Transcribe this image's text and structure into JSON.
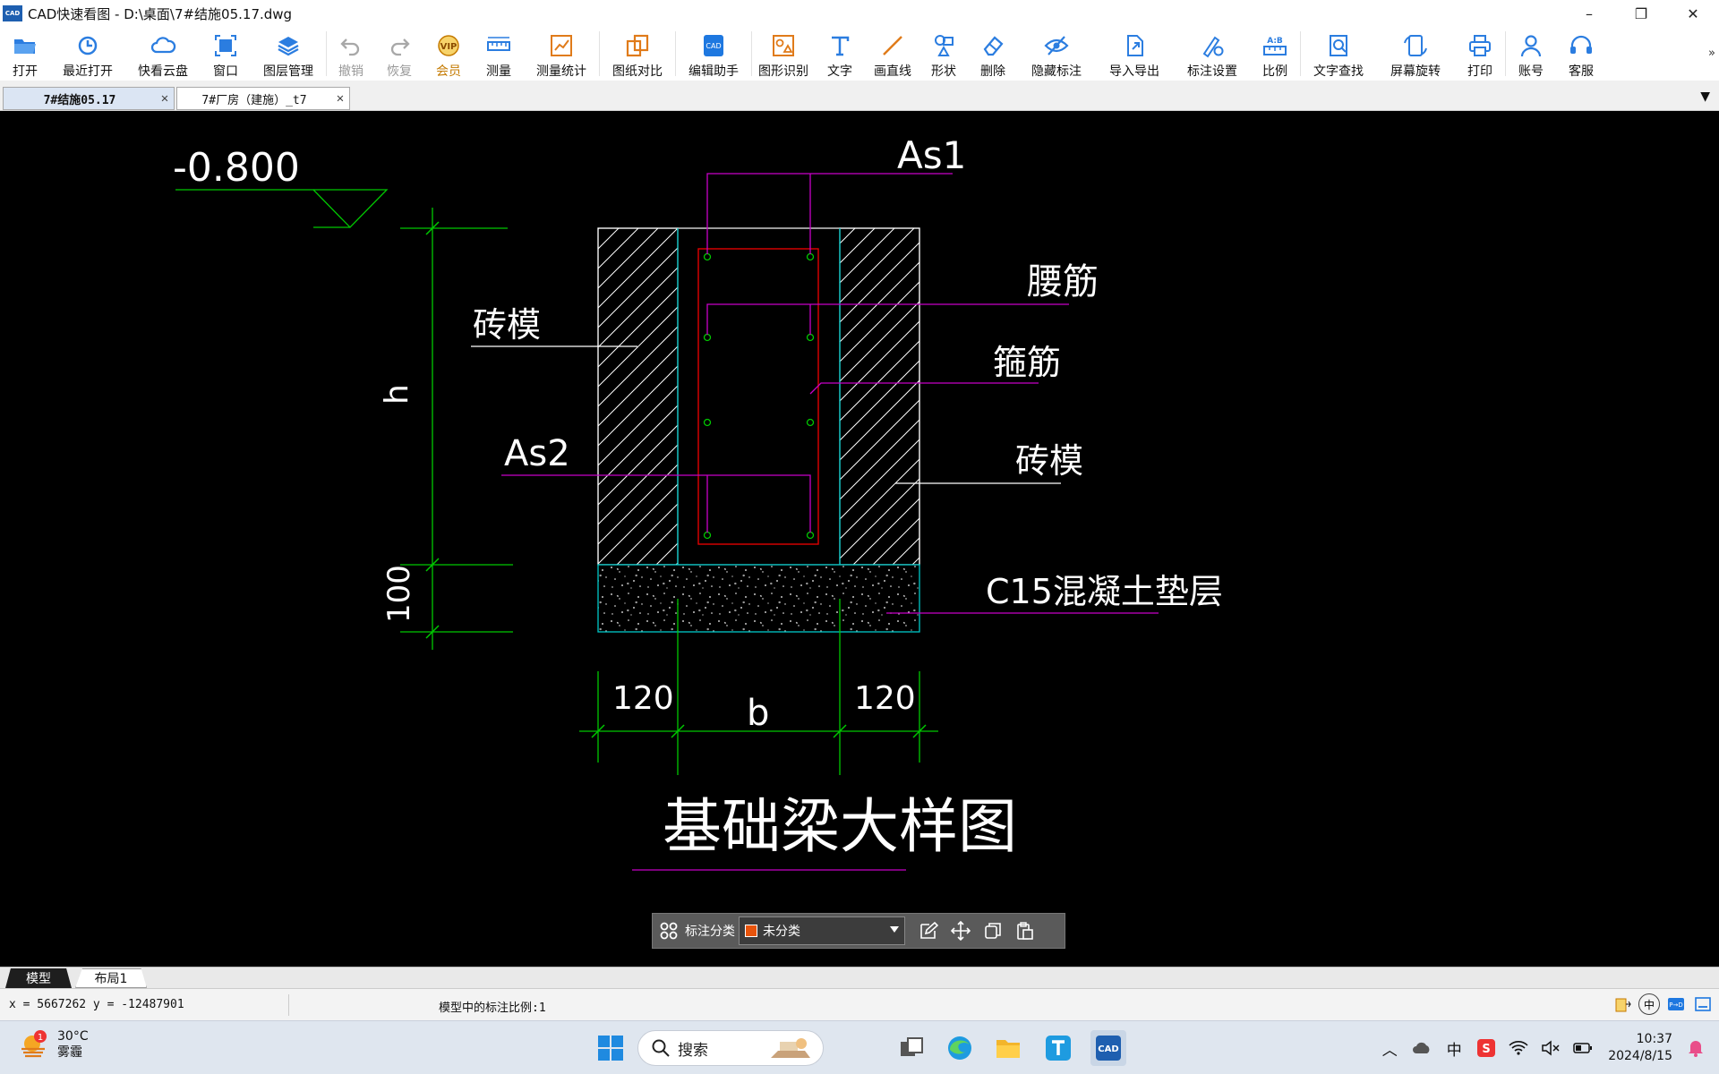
{
  "window": {
    "app_icon_text": "CAD",
    "title": "CAD快速看图 - D:\\桌面\\7#结施05.17.dwg",
    "minimize": "–",
    "restore": "❐",
    "close": "✕"
  },
  "toolbar": {
    "items": [
      {
        "label": "打开",
        "icon": "folder-open-icon"
      },
      {
        "label": "最近打开",
        "icon": "history-icon"
      },
      {
        "label": "快看云盘",
        "icon": "cloud-icon"
      },
      {
        "label": "窗口",
        "icon": "window-icon"
      },
      {
        "label": "图层管理",
        "icon": "layers-icon"
      },
      {
        "label": "撤销",
        "icon": "undo-icon"
      },
      {
        "label": "恢复",
        "icon": "redo-icon"
      },
      {
        "label": "会员",
        "icon": "vip-icon"
      },
      {
        "label": "测量",
        "icon": "ruler-icon"
      },
      {
        "label": "测量统计",
        "icon": "measure-stats-icon"
      },
      {
        "label": "图纸对比",
        "icon": "compare-icon"
      },
      {
        "label": "编辑助手",
        "icon": "edit-assistant-icon"
      },
      {
        "label": "图形识别",
        "icon": "shape-recognition-icon"
      },
      {
        "label": "文字",
        "icon": "text-icon"
      },
      {
        "label": "画直线",
        "icon": "line-icon"
      },
      {
        "label": "形状",
        "icon": "shapes-icon"
      },
      {
        "label": "删除",
        "icon": "eraser-icon"
      },
      {
        "label": "隐藏标注",
        "icon": "eye-hide-icon"
      },
      {
        "label": "导入导出",
        "icon": "import-export-icon"
      },
      {
        "label": "标注设置",
        "icon": "annotation-settings-icon"
      },
      {
        "label": "比例",
        "icon": "scale-icon"
      },
      {
        "label": "文字查找",
        "icon": "text-search-icon"
      },
      {
        "label": "屏幕旋转",
        "icon": "rotate-screen-icon"
      },
      {
        "label": "打印",
        "icon": "printer-icon"
      },
      {
        "label": "账号",
        "icon": "account-icon"
      },
      {
        "label": "客服",
        "icon": "headset-icon"
      }
    ],
    "more": "»",
    "vip_badge": "VIP"
  },
  "tabs": {
    "items": [
      {
        "label": "7#结施05.17",
        "close": "✕"
      },
      {
        "label": "7#厂房（建施）_t7",
        "close": "✕"
      }
    ],
    "menu": "▼"
  },
  "drawing": {
    "elevation": "-0.800",
    "label_as1": "As1",
    "label_waist_rebar": "腰筋",
    "label_brick_form_left": "砖模",
    "label_stirrup": "箍筋",
    "label_brick_form_right": "砖模",
    "label_as2": "As2",
    "label_cushion": "C15混凝土垫层",
    "dim_h": "h",
    "dim_100": "100",
    "dim_120_left": "120",
    "dim_b": "b",
    "dim_120_right": "120",
    "title": "基础梁大样图"
  },
  "annotation_bar": {
    "label": "标注分类",
    "selected": "未分类",
    "swatch_color": "#e8540c"
  },
  "layout_tabs": [
    "模型",
    "布局1"
  ],
  "status": {
    "coords": "x = 5667262 y = -12487901",
    "scale": "模型中的标注比例:1"
  },
  "taskbar": {
    "weather_temp": "30°C",
    "weather_desc": "雾霾",
    "weather_badge": "1",
    "search_placeholder": "搜索",
    "ime": "中",
    "time": "10:37",
    "date": "2024/8/15"
  },
  "colors": {
    "canvas_bg": "#000000",
    "cad_green": "#00c800",
    "cad_cyan": "#00c8c8",
    "cad_magenta": "#c800c8",
    "cad_red": "#e00000",
    "cad_white": "#ffffff"
  }
}
